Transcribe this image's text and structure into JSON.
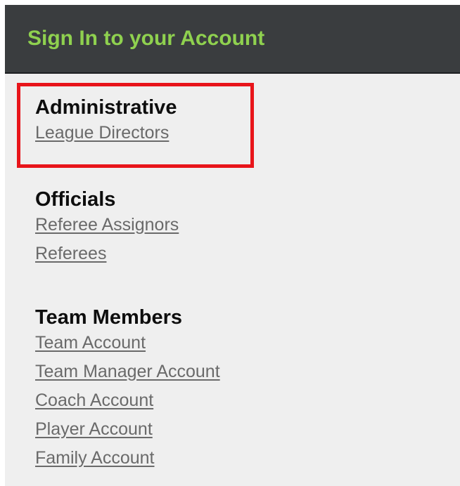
{
  "header": {
    "title": "Sign In to your Account"
  },
  "sections": [
    {
      "heading": "Administrative",
      "links": [
        "League Directors"
      ]
    },
    {
      "heading": "Officials",
      "links": [
        "Referee Assignors",
        "Referees"
      ]
    },
    {
      "heading": "Team Members",
      "links": [
        "Team Account",
        "Team Manager Account",
        "Coach Account",
        "Player Account",
        "Family Account"
      ]
    }
  ],
  "colors": {
    "header_background": "#3a3d3f",
    "header_title": "#8fd14f",
    "panel_background": "#efefef",
    "heading_text": "#0e0e0e",
    "link_text": "#6a6a6a",
    "highlight_border": "#e8141a"
  },
  "annotations": {
    "highlight": "League Directors"
  }
}
